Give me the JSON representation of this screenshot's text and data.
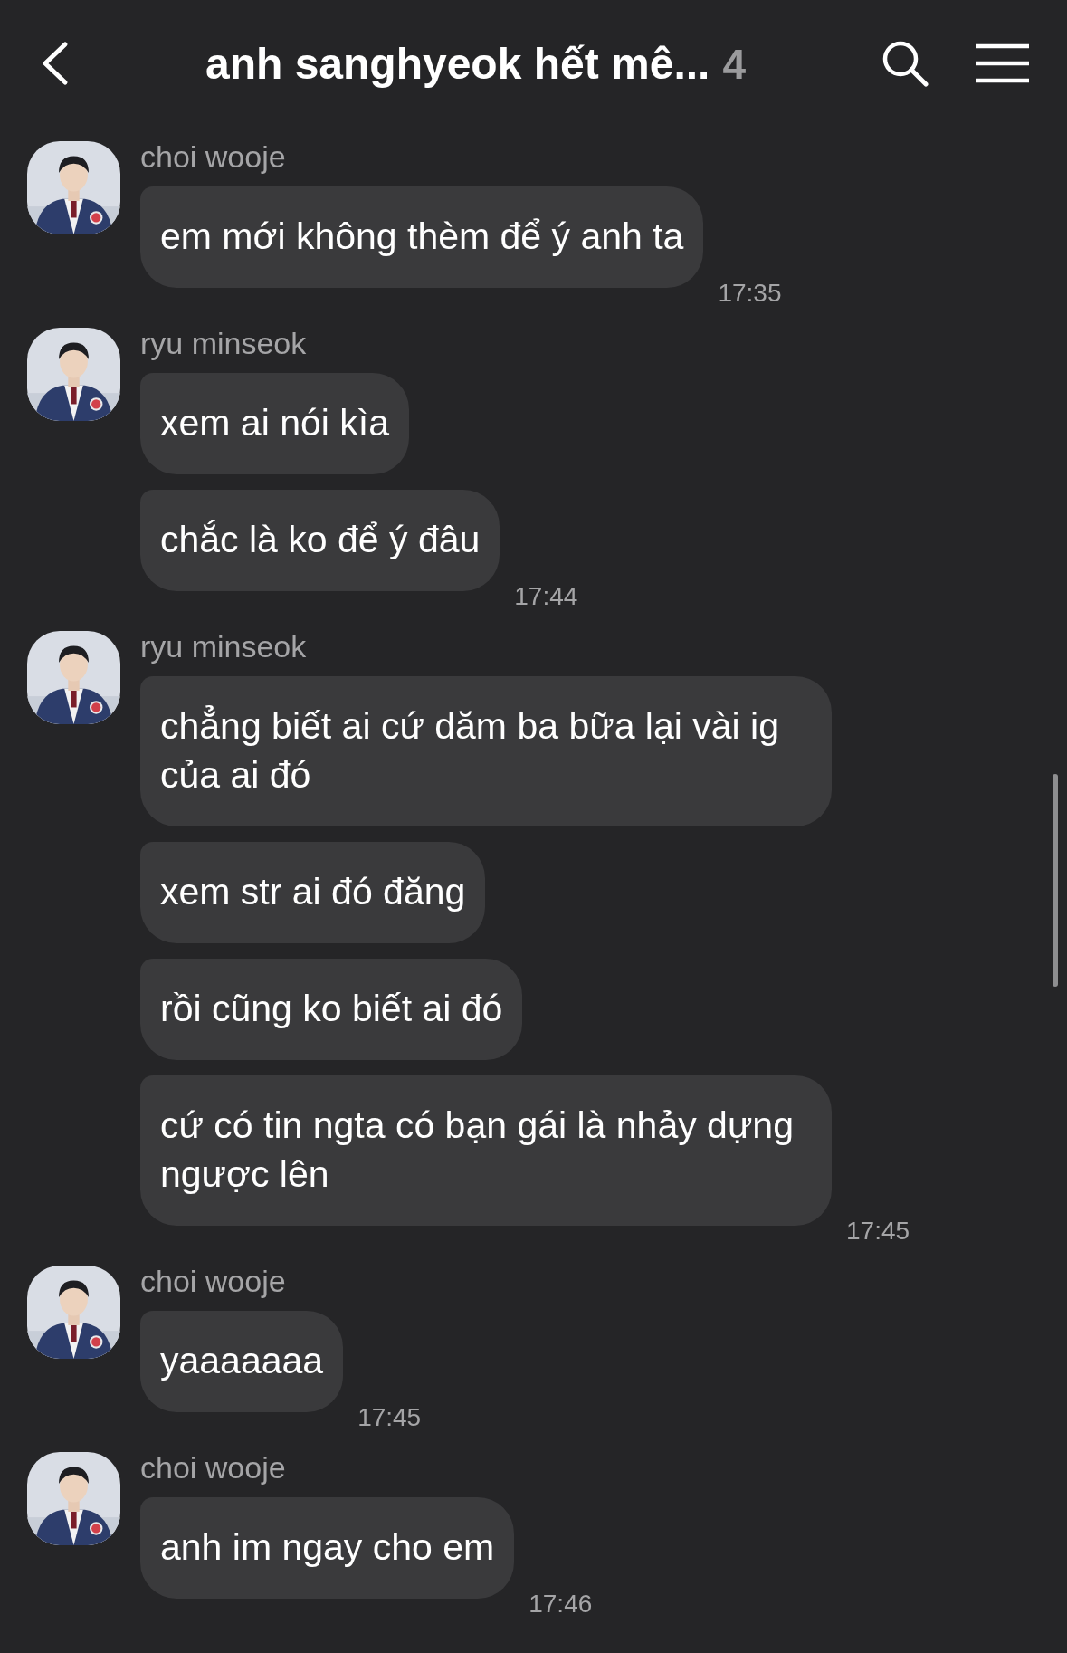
{
  "header": {
    "title": "anh sanghyeok hết mê...",
    "member_count": "4"
  },
  "groups": [
    {
      "sender": "choi wooje",
      "avatar": {
        "kind": "picture"
      },
      "messages": [
        "em mới không thèm để ý anh ta"
      ],
      "time": "17:35"
    },
    {
      "sender": "ryu minseok",
      "avatar": {
        "kind": "picture"
      },
      "messages": [
        "xem ai nói kìa",
        "chắc là ko để ý đâu"
      ],
      "time": "17:44"
    },
    {
      "sender": "ryu minseok",
      "avatar": {
        "kind": "picture"
      },
      "messages": [
        "chẳng biết ai cứ dăm ba bữa lại vài ig của ai đó",
        "xem str ai đó đăng",
        "rồi cũng ko biết ai đó",
        "cứ có tin ngta có bạn gái là nhảy dựng ngược lên"
      ],
      "time": "17:45"
    },
    {
      "sender": "choi wooje",
      "avatar": {
        "kind": "picture"
      },
      "messages": [
        "yaaaaaaa"
      ],
      "time": "17:45"
    },
    {
      "sender": "choi wooje",
      "avatar": {
        "kind": "picture"
      },
      "messages": [
        "anh im ngay cho em"
      ],
      "time": "17:46"
    }
  ]
}
